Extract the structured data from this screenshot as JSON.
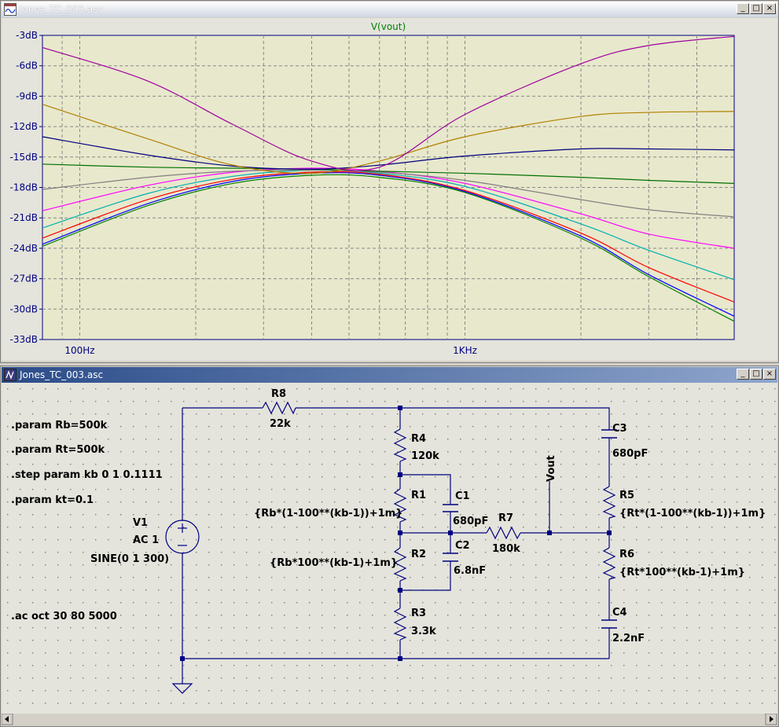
{
  "plot_window": {
    "title": "Jones_TC_003.asc",
    "trace_label": "V(vout)",
    "buttons": {
      "minimize": "_",
      "maximize": "□",
      "close": "×"
    }
  },
  "schematic_window": {
    "title": "Jones_TC_003.asc",
    "buttons": {
      "minimize": "_",
      "maximize": "□",
      "close": "×"
    },
    "directives": [
      ".param Rb=500k",
      ".param Rt=500k",
      ".step param kb 0 1 0.1111",
      ".param kt=0.1",
      ".ac oct 30 80 5000"
    ],
    "components": {
      "R8": {
        "name": "R8",
        "value": "22k"
      },
      "R4": {
        "name": "R4",
        "value": "120k"
      },
      "R1": {
        "name": "R1",
        "value": "{Rb*(1-100**(kb-1))+1m}"
      },
      "R2": {
        "name": "R2",
        "value": "{Rb*100**(kb-1)+1m}"
      },
      "R3": {
        "name": "R3",
        "value": "3.3k"
      },
      "C1": {
        "name": "C1",
        "value": "680pF"
      },
      "C2": {
        "name": "C2",
        "value": "6.8nF"
      },
      "R7": {
        "name": "R7",
        "value": "180k"
      },
      "C3": {
        "name": "C3",
        "value": "680pF"
      },
      "R5": {
        "name": "R5",
        "value": "{Rt*(1-100**(kb-1))+1m}"
      },
      "R6": {
        "name": "R6",
        "value": "{Rt*100**(kb-1)+1m}"
      },
      "C4": {
        "name": "C4",
        "value": "2.2nF"
      },
      "V1": {
        "name": "V1",
        "line2": "AC 1",
        "line3": "SINE(0 1 300)"
      }
    },
    "net_label": "Vout"
  },
  "chart_data": {
    "type": "line",
    "title": "V(vout)",
    "xlabel": "",
    "ylabel": "",
    "x_scale": "log",
    "xlim": [
      80,
      5000
    ],
    "ylim": [
      -33,
      -3
    ],
    "grid": true,
    "x_tick_labels": [
      {
        "value": 100,
        "label": "100Hz"
      },
      {
        "value": 1000,
        "label": "1KHz"
      }
    ],
    "y_tick_labels": [
      "-3dB",
      "-6dB",
      "-9dB",
      "-12dB",
      "-15dB",
      "-18dB",
      "-21dB",
      "-24dB",
      "-27dB",
      "-30dB",
      "-33dB"
    ],
    "x": [
      80,
      150,
      250,
      400,
      600,
      1000,
      2000,
      3000,
      5000
    ],
    "series": [
      {
        "color": "#008000",
        "values": [
          -23.8,
          -19.8,
          -17.6,
          -16.8,
          -17.0,
          -18.5,
          -23.0,
          -26.8,
          -31.2
        ]
      },
      {
        "color": "#0000ff",
        "values": [
          -23.6,
          -19.6,
          -17.4,
          -16.6,
          -16.8,
          -18.4,
          -22.8,
          -26.6,
          -30.7
        ]
      },
      {
        "color": "#ff0000",
        "values": [
          -23.0,
          -19.2,
          -17.2,
          -16.5,
          -16.7,
          -18.3,
          -22.5,
          -25.9,
          -29.3
        ]
      },
      {
        "color": "#00b0b0",
        "values": [
          -22.0,
          -18.6,
          -16.9,
          -16.3,
          -16.6,
          -17.9,
          -21.6,
          -24.2,
          -27.1
        ]
      },
      {
        "color": "#ff00ff",
        "values": [
          -20.3,
          -17.8,
          -16.5,
          -16.1,
          -16.4,
          -17.6,
          -20.6,
          -22.6,
          -24.0
        ]
      },
      {
        "color": "#808080",
        "values": [
          -18.2,
          -17.0,
          -16.4,
          -16.3,
          -16.5,
          -17.3,
          -19.2,
          -20.2,
          -20.9
        ]
      },
      {
        "color": "#007000",
        "values": [
          -15.7,
          -16.0,
          -16.1,
          -16.2,
          -16.4,
          -16.6,
          -17.0,
          -17.3,
          -17.6
        ]
      },
      {
        "color": "#00007f",
        "values": [
          -13.0,
          -14.8,
          -15.9,
          -16.2,
          -15.8,
          -14.9,
          -14.2,
          -14.2,
          -14.3
        ]
      },
      {
        "color": "#b08000",
        "values": [
          -9.8,
          -13.2,
          -15.8,
          -16.6,
          -15.4,
          -13.0,
          -11.0,
          -10.6,
          -10.5
        ]
      },
      {
        "color": "#a000a0",
        "values": [
          -4.2,
          -7.5,
          -11.8,
          -15.4,
          -16.0,
          -10.8,
          -5.8,
          -4.0,
          -3.1
        ]
      }
    ]
  }
}
